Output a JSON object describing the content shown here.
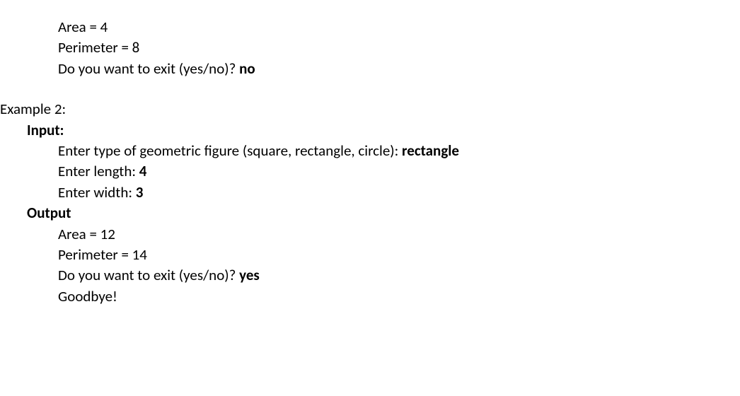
{
  "example1_output": {
    "area_line": "Area = 4",
    "perimeter_line": "Perimeter = 8",
    "exit_prompt": "Do you want to exit (yes/no)? ",
    "exit_answer": "no"
  },
  "example2": {
    "heading": "Example 2:",
    "input_label": "Input:",
    "figure_prompt": "Enter type of geometric figure (square, rectangle, circle): ",
    "figure_value": "rectangle",
    "length_prompt": "Enter length: ",
    "length_value": "4",
    "width_prompt": "Enter width: ",
    "width_value": "3",
    "output_label": "Output",
    "area_line": "Area = 12",
    "perimeter_line": "Perimeter = 14",
    "exit_prompt": "Do you want to exit (yes/no)? ",
    "exit_answer": "yes",
    "goodbye": "Goodbye!"
  }
}
